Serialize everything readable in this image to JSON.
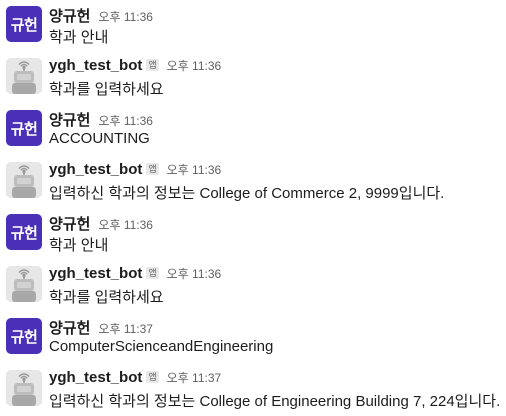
{
  "messages": [
    {
      "type": "user",
      "avatar_text": "규헌",
      "name": "양규헌",
      "time": "오후 11:36",
      "text": "학과 안내"
    },
    {
      "type": "bot",
      "name": "ygh_test_bot",
      "badge": "앱",
      "time": "오후 11:36",
      "text": "학과를 입력하세요"
    },
    {
      "type": "user",
      "avatar_text": "규헌",
      "name": "양규헌",
      "time": "오후 11:36",
      "text": "ACCOUNTING"
    },
    {
      "type": "bot",
      "name": "ygh_test_bot",
      "badge": "앱",
      "time": "오후 11:36",
      "text": "입력하신 학과의 정보는 College of Commerce 2, 9999입니다."
    },
    {
      "type": "user",
      "avatar_text": "규헌",
      "name": "양규헌",
      "time": "오후 11:36",
      "text": "학과 안내"
    },
    {
      "type": "bot",
      "name": "ygh_test_bot",
      "badge": "앱",
      "time": "오후 11:36",
      "text": "학과를 입력하세요"
    },
    {
      "type": "user",
      "avatar_text": "규헌",
      "name": "양규헌",
      "time": "오후 11:37",
      "text": "ComputerScienceandEngineering"
    },
    {
      "type": "bot",
      "name": "ygh_test_bot",
      "badge": "앱",
      "time": "오후 11:37",
      "text": "입력하신 학과의 정보는 College of Engineering Building 7, 224입니다."
    }
  ]
}
